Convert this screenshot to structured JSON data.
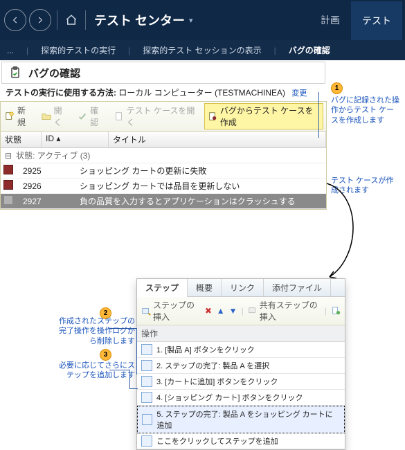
{
  "ribbon": {
    "title": "テスト センター",
    "tabs": {
      "plan": "計画",
      "test": "テスト"
    }
  },
  "subnav": {
    "more": "...",
    "run": "探索的テストの実行",
    "session": "探索的テスト セッションの表示",
    "bugs": "バグの確認"
  },
  "page": {
    "title": "バグの確認",
    "method_label": "テストの実行に使用する方法:",
    "method_value": "ローカル コンピューター (TESTMACHINEA)",
    "change": "変更"
  },
  "toolbar": {
    "new": "新規",
    "open": "開く",
    "confirm": "確認",
    "opentc": "テスト ケースを開く",
    "create": "バグからテスト ケースを作成"
  },
  "grid": {
    "state_hdr": "状態",
    "id_hdr": "ID",
    "title_hdr": "タイトル",
    "group": "状態: アクティブ (3)",
    "rows": [
      {
        "id": "2925",
        "title": "ショッピング カートの更新に失敗"
      },
      {
        "id": "2926",
        "title": "ショッピング カートでは品目を更新しない"
      },
      {
        "id": "2927",
        "title": "負の品質を入力するとアプリケーションはクラッシュする"
      }
    ]
  },
  "callout1": "バグに記録された操作からテスト ケースを作成します",
  "callout_mid": "テスト ケースが作成されます",
  "callout2": "作成されたステップの完了操作を操作ログから削除します",
  "callout3": "必要に応じてさらにステップを追加します",
  "detail": {
    "tabs": {
      "steps": "ステップ",
      "overview": "概要",
      "links": "リンク",
      "attach": "添付ファイル"
    },
    "tb": {
      "insert": "ステップの挿入",
      "shared": "共有ステップの挿入"
    },
    "section": "操作",
    "steps": [
      "1. [製品 A] ボタンをクリック",
      "2. ステップの完了: 製品 A を選択",
      "3. [カートに追加] ボタンをクリック",
      "4. [ショッピング カート] ボタンをクリック",
      "5. ステップの完了: 製品 A をショッピング カートに追加",
      "ここをクリックしてステップを追加"
    ]
  }
}
